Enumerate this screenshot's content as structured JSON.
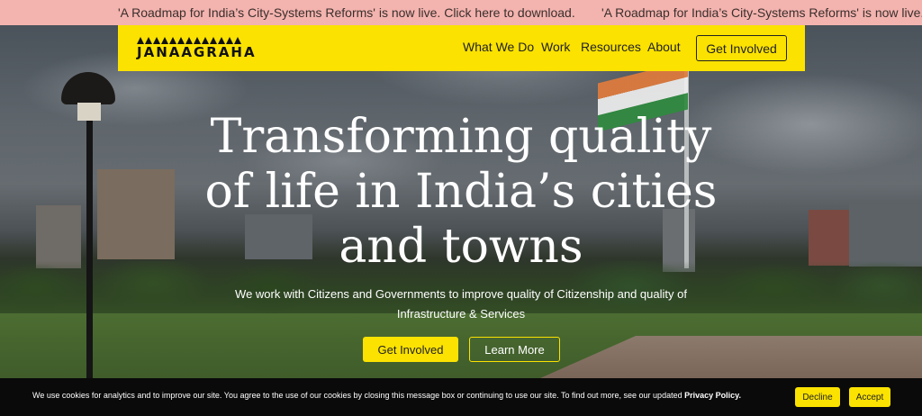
{
  "announcement": {
    "text": "'A Roadmap for India’s City-Systems Reforms' is now live. Click here to download."
  },
  "header": {
    "logo_text": "JANAAGRAHA",
    "nav": [
      "What We Do",
      "Work",
      "Resources",
      "About"
    ],
    "cta_label": "Get Involved"
  },
  "hero": {
    "title_lines": [
      "Transforming quality",
      "of life in India’s cities",
      "and towns"
    ],
    "subtitle": "We work with Citizens and Governments to improve quality of Citizenship and quality of Infrastructure & Services",
    "primary_label": "Get Involved",
    "secondary_label": "Learn More"
  },
  "cookie": {
    "text": "We use cookies for analytics and to improve our site. You agree to the use of our cookies by closing this message box or continuing to use our site. To find out more, see our updated ",
    "link_label": "Privacy Policy.",
    "decline_label": "Decline",
    "accept_label": "Accept"
  },
  "colors": {
    "brand_yellow": "#fbe200",
    "announcement_bg": "#f3b3ae",
    "cookie_bg": "#0a0a0a"
  },
  "icons": [
    "janaagraha-logo-icon"
  ]
}
